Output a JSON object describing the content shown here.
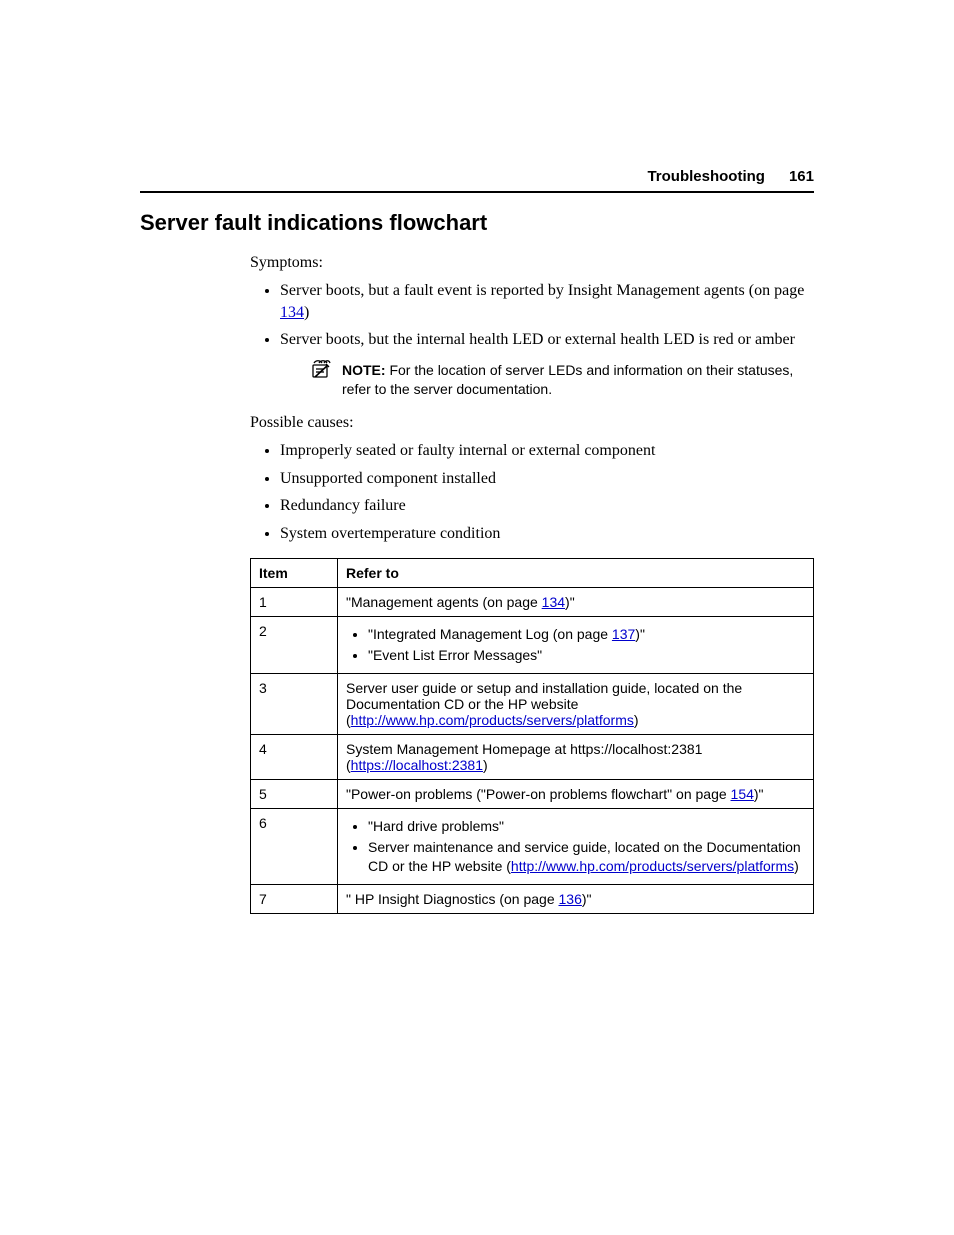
{
  "header": {
    "section": "Troubleshooting",
    "page_number": "161"
  },
  "title": "Server fault indications flowchart",
  "symptoms_label": "Symptoms:",
  "symptoms": {
    "s1_pre": "Server boots, but a fault event is reported by Insight Management agents (on page ",
    "s1_link": "134",
    "s1_post": ")",
    "s2": "Server boots, but the internal health LED or external health LED is red or amber"
  },
  "note": {
    "label": "NOTE:",
    "text": "  For the location of server LEDs and information on their statuses, refer to the server documentation."
  },
  "causes_label": "Possible causes:",
  "causes": [
    "Improperly seated or faulty internal or external component",
    "Unsupported component installed",
    "Redundancy failure",
    "System overtemperature condition"
  ],
  "table": {
    "h_item": "Item",
    "h_refer": "Refer to",
    "rows": {
      "r1": {
        "item": "1",
        "pre": "\"Management agents (on page ",
        "link": "134",
        "post": ")\""
      },
      "r2": {
        "item": "2",
        "b1_pre": "\"Integrated Management Log (on page ",
        "b1_link": "137",
        "b1_post": ")\"",
        "b2": "\"Event List Error Messages\""
      },
      "r3": {
        "item": "3",
        "pre": "Server user guide or setup and installation guide, located on the Documentation CD or the HP website (",
        "link": "http://www.hp.com/products/servers/platforms",
        "post": ")"
      },
      "r4": {
        "item": "4",
        "pre": "System Management Homepage at https://localhost:2381 (",
        "link": "https://localhost:2381",
        "post": ")"
      },
      "r5": {
        "item": "5",
        "pre": "\"Power-on problems (\"Power-on problems flowchart\" on page ",
        "link": "154",
        "post": ")\""
      },
      "r6": {
        "item": "6",
        "b1": "\"Hard drive problems\"",
        "b2_pre": "Server maintenance and service guide, located on the Documentation CD or the HP website (",
        "b2_link": "http://www.hp.com/products/servers/platforms",
        "b2_post": ")"
      },
      "r7": {
        "item": "7",
        "pre": "\" HP Insight Diagnostics (on page ",
        "link": "136",
        "post": ")\""
      }
    }
  }
}
